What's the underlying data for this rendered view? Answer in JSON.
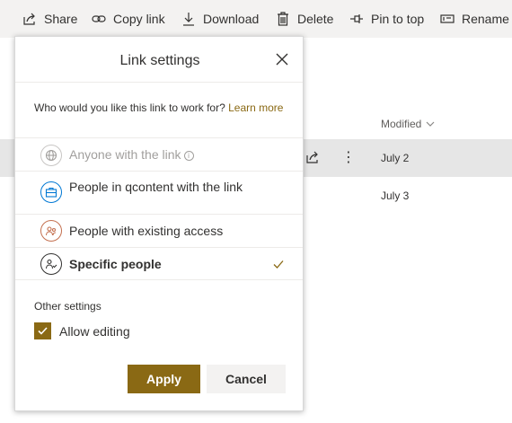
{
  "commandbar": {
    "share": {
      "label": "Share",
      "icon": "share-icon"
    },
    "copy_link": {
      "label": "Copy link",
      "icon": "link-icon"
    },
    "download": {
      "label": "Download",
      "icon": "download-icon"
    },
    "delete": {
      "label": "Delete",
      "icon": "trash-icon"
    },
    "pin": {
      "label": "Pin to top",
      "icon": "pin-icon"
    },
    "rename": {
      "label": "Rename",
      "icon": "rename-icon"
    }
  },
  "list": {
    "column_modified": "Modified",
    "rows": [
      {
        "modified": "July 2",
        "selected": true
      },
      {
        "modified": "July 3",
        "selected": false
      }
    ]
  },
  "dialog": {
    "title": "Link settings",
    "question": "Who would you like this link to work for?",
    "learn_more": "Learn more",
    "options": [
      {
        "label": "Anyone with the link",
        "icon": "globe-icon",
        "enabled": false
      },
      {
        "label": "People in qcontent with the link",
        "icon": "briefcase-icon",
        "enabled": true
      },
      {
        "label": "People with existing access",
        "icon": "people-icon",
        "enabled": true
      },
      {
        "label": "Specific people",
        "icon": "person-icon",
        "enabled": true,
        "selected": true
      }
    ],
    "other_settings_title": "Other settings",
    "allow_editing": {
      "label": "Allow editing",
      "checked": true
    },
    "apply_label": "Apply",
    "cancel_label": "Cancel"
  },
  "colors": {
    "accent": "#8a6914",
    "commandbar_bg": "#f3f2f1",
    "selected_row_bg": "#e6e6e6",
    "org_icon": "#0078d4",
    "existing_icon": "#c4704f"
  }
}
